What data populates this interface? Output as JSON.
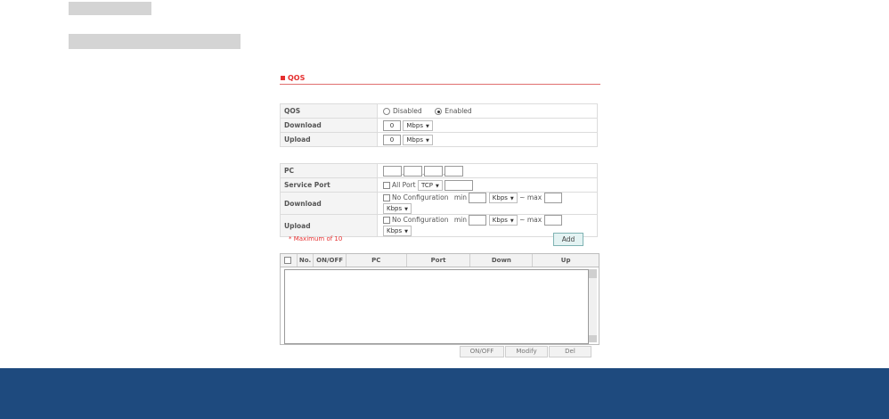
{
  "qos_title": "QOS",
  "form1": {
    "qos_label": "QOS",
    "disabled_label": "Disabled",
    "enabled_label": "Enabled",
    "download_label": "Download",
    "download_value": "0",
    "download_unit": "Mbps",
    "upload_label": "Upload",
    "upload_value": "0",
    "upload_unit": "Mbps"
  },
  "form2": {
    "pc_label": "PC",
    "service_port_label": "Service Port",
    "all_port_label": "All Port",
    "protocol": "TCP",
    "download_label": "Download",
    "upload_label": "Upload",
    "no_config_label": "No Configuration",
    "min_label": "min",
    "max_label": "~ max",
    "kbps_unit": "Kbps"
  },
  "max_note": "* Maximum of 10",
  "add_label": "Add",
  "list": {
    "headers": {
      "no": "No.",
      "onoff": "ON/OFF",
      "pc": "PC",
      "port": "Port",
      "down": "Down",
      "up": "Up"
    }
  },
  "buttons": {
    "onoff": "ON/OFF",
    "modify": "Modify",
    "del": "Del"
  },
  "colors": {
    "accent": "#e53030",
    "footer": "#1e4a7e"
  }
}
